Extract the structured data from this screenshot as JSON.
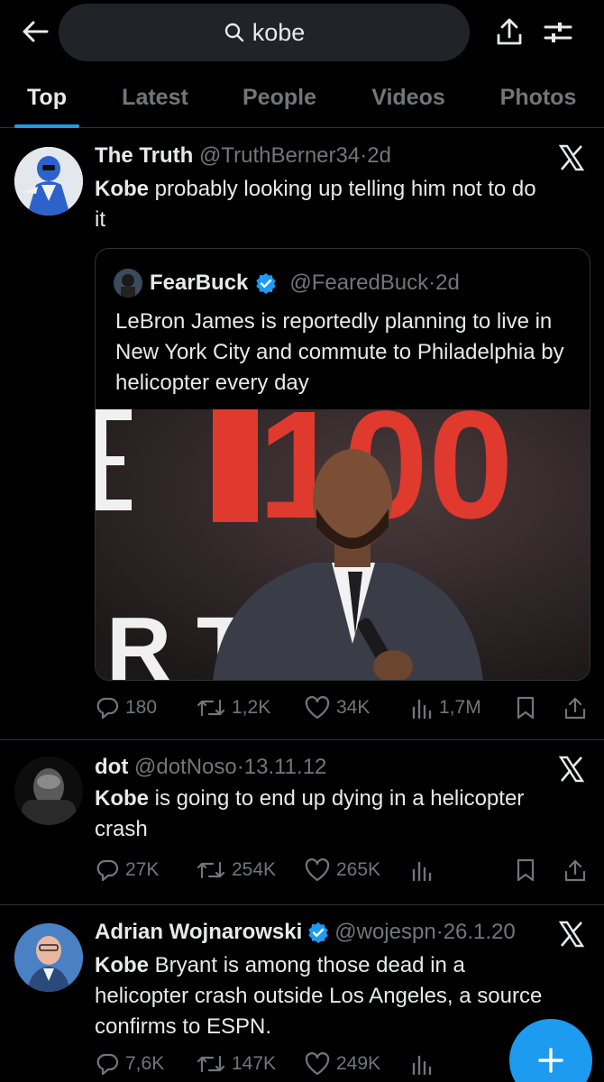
{
  "search": {
    "query": "kobe"
  },
  "tabs": [
    {
      "label": "Top",
      "active": true
    },
    {
      "label": "Latest",
      "active": false
    },
    {
      "label": "People",
      "active": false
    },
    {
      "label": "Videos",
      "active": false
    },
    {
      "label": "Photos",
      "active": false
    }
  ],
  "tweets": [
    {
      "name": "The Truth",
      "handle": "@TruthBerner34",
      "time": "2d",
      "keyword": "Kobe",
      "text_line1": " probably looking up telling him not to do",
      "text_line2": "it",
      "quote": {
        "name": "FearBuck",
        "verified": true,
        "handle": "@FearedBuck",
        "time": "2d",
        "text": "LeBron James is reportedly planning to live in New York City and commute to Philadelphia by helicopter every day",
        "image_sign_text": "100"
      },
      "replies": "180",
      "retweets": "1,2K",
      "likes": "34K",
      "views": "1,7M"
    },
    {
      "name": "dot",
      "handle": "@dotNoso",
      "time": "13.11.12",
      "keyword": "Kobe",
      "text_line1": " is going to end up dying in a helicopter",
      "text_line2": "crash",
      "replies": "27K",
      "retweets": "254K",
      "likes": "265K",
      "views": ""
    },
    {
      "name": "Adrian Wojnarowski",
      "verified": true,
      "handle": "@wojespn",
      "time": "26.1.20",
      "keyword": "Kobe",
      "text_line1": " Bryant is among those dead in a",
      "text_line2": "helicopter crash outside Los Angeles, a source",
      "text_line3": "confirms to ESPN.",
      "replies": "7,6K",
      "retweets": "147K",
      "likes": "249K",
      "views": ""
    }
  ],
  "colors": {
    "accent": "#1d9bf0",
    "muted": "#71767b",
    "background": "#000000",
    "text": "#e7e9ea"
  },
  "icons": [
    "back-arrow-icon",
    "search-icon",
    "share-icon",
    "filter-icon",
    "x-logo-icon",
    "reply-icon",
    "retweet-icon",
    "like-icon",
    "views-icon",
    "bookmark-icon",
    "compose-icon",
    "verified-icon"
  ]
}
